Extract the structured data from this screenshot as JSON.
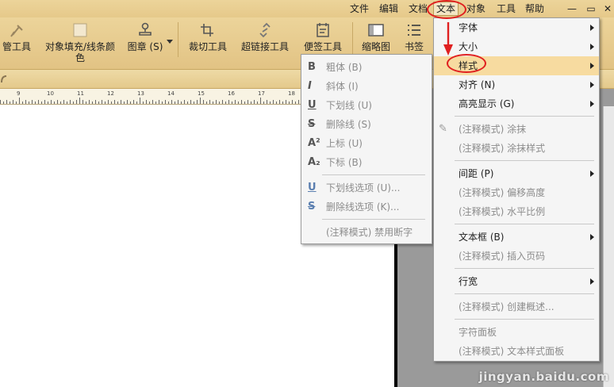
{
  "menubar": {
    "items": [
      "文件",
      "编辑",
      "文档",
      "文本",
      "对象",
      "工具",
      "帮助"
    ],
    "window_buttons": [
      "—",
      "▭",
      "✕"
    ]
  },
  "toolbar": {
    "tools": [
      {
        "label": "管工具",
        "icon": "pin-icon"
      },
      {
        "label": "对象填充/线条颜色",
        "icon": "fill-color-icon"
      },
      {
        "label": "图章 (S)",
        "icon": "stamp-icon"
      },
      {
        "label": "裁切工具",
        "icon": "crop-icon"
      },
      {
        "label": "超链接工具",
        "icon": "link-icon"
      },
      {
        "label": "便签工具",
        "icon": "note-icon"
      },
      {
        "label": "缩略图",
        "icon": "thumbnail-icon"
      },
      {
        "label": "书签",
        "icon": "bookmark-list-icon"
      }
    ]
  },
  "ruler": {
    "labels": [
      "9",
      "10",
      "11",
      "12",
      "13",
      "14",
      "15",
      "16",
      "17",
      "18",
      "19",
      "20",
      "21"
    ]
  },
  "text_menu": {
    "items": [
      {
        "label": "字体",
        "submenu": true,
        "disabled": false
      },
      {
        "label": "大小",
        "submenu": true,
        "disabled": false
      },
      {
        "label": "样式",
        "submenu": true,
        "disabled": false,
        "highlighted": true
      },
      {
        "label": "对齐 (N)",
        "submenu": true,
        "disabled": false
      },
      {
        "label": "高亮显示 (G)",
        "submenu": true,
        "disabled": false
      },
      {
        "label": "(注释模式) 涂抹",
        "submenu": false,
        "disabled": true
      },
      {
        "label": "(注释模式) 涂抹样式",
        "submenu": false,
        "disabled": true
      },
      {
        "label": "间距 (P)",
        "submenu": true,
        "disabled": false
      },
      {
        "label": "(注释模式) 偏移高度",
        "submenu": false,
        "disabled": true
      },
      {
        "label": "(注释模式) 水平比例",
        "submenu": false,
        "disabled": true
      },
      {
        "label": "文本框 (B)",
        "submenu": true,
        "disabled": false
      },
      {
        "label": "(注释模式) 插入页码",
        "submenu": false,
        "disabled": true
      },
      {
        "label": "行宽",
        "submenu": true,
        "disabled": false
      },
      {
        "label": "(注释模式) 创建概述...",
        "submenu": false,
        "disabled": true
      },
      {
        "label": "字符面板",
        "submenu": false,
        "disabled": true
      },
      {
        "label": "(注释模式) 文本样式面板",
        "submenu": false,
        "disabled": true
      }
    ]
  },
  "style_submenu": {
    "items": [
      {
        "glyph": "B",
        "label": "粗体 (B)"
      },
      {
        "glyph": "I",
        "label": "斜体 (I)"
      },
      {
        "glyph": "U",
        "label": "下划线 (U)"
      },
      {
        "glyph": "S",
        "label": "删除线 (S)"
      },
      {
        "glyph": "A²",
        "label": "上标 (U)"
      },
      {
        "glyph": "A₂",
        "label": "下标 (B)"
      },
      {
        "glyph": "U",
        "label": "下划线选项 (U)..."
      },
      {
        "glyph": "S",
        "label": "删除线选项 (K)..."
      },
      {
        "glyph": "",
        "label": "(注释模式) 禁用断字"
      }
    ]
  },
  "watermark": "jingyan.baidu.com"
}
